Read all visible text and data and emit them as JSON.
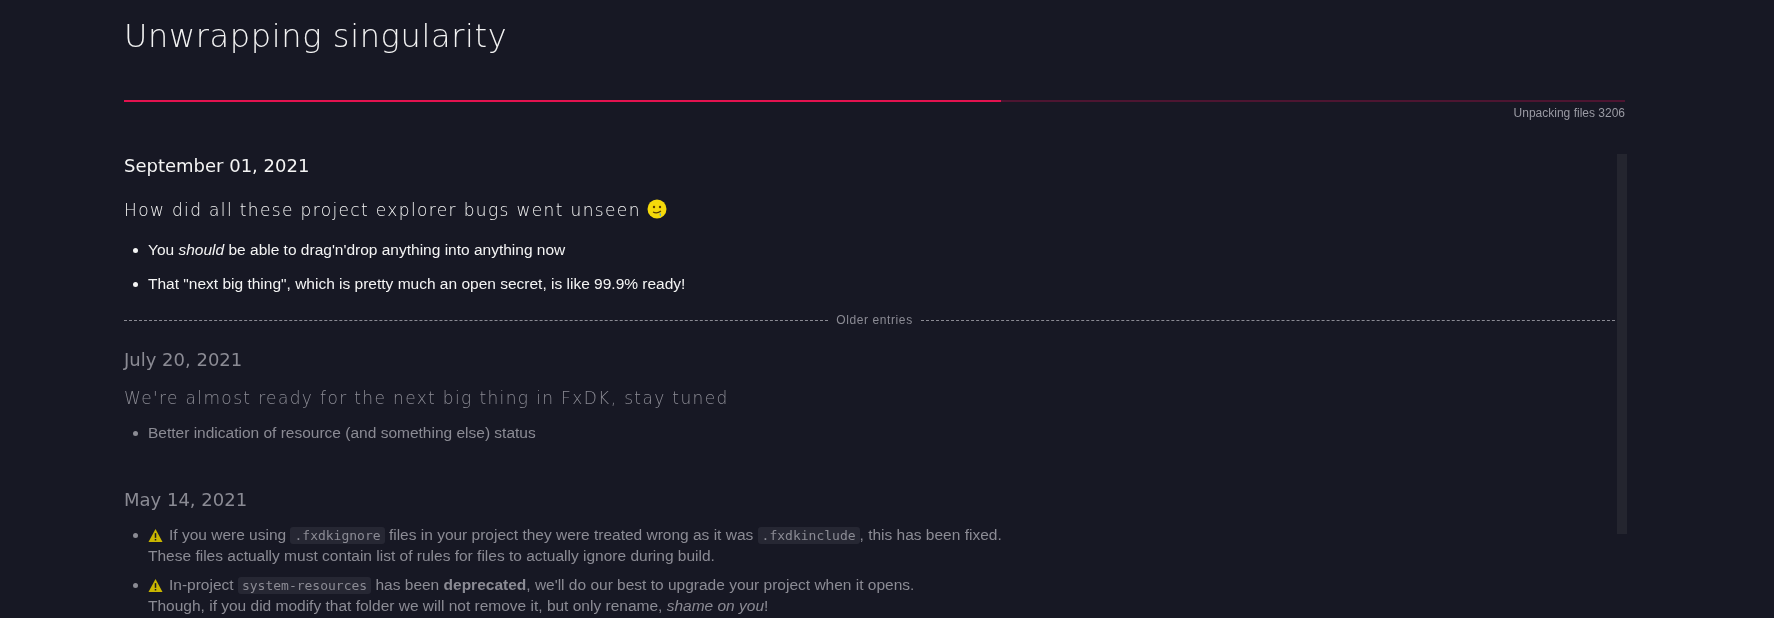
{
  "title": "Unwrapping singularity",
  "progress": {
    "level": 0.584,
    "status": "Unpacking files 3206"
  },
  "latest": {
    "date": "September 01, 2021",
    "heading": "How did all these project explorer bugs went unseen",
    "heading_emoji": true,
    "items": [
      {
        "warning": false,
        "lines": [
          [
            {
              "kind": "text",
              "text": "You *should* be able to drag'n'drop anything into anything now"
            }
          ]
        ]
      },
      {
        "warning": false,
        "lines": [
          [
            {
              "kind": "text",
              "text": "That \"next big thing\", which is pretty much an open secret, is like 99.9% ready!"
            }
          ]
        ]
      }
    ]
  },
  "older_label": "Older entries",
  "older": [
    {
      "date": "July 20, 2021",
      "heading": "We're almost ready for the next big thing in FxDK, stay tuned",
      "heading_emoji": false,
      "items": [
        {
          "warning": false,
          "lines": [
            [
              {
                "kind": "text",
                "text": "Better indication of resource (and something else) status"
              }
            ]
          ]
        }
      ]
    },
    {
      "date": "May 14, 2021",
      "items": [
        {
          "warning": true,
          "lines": [
            [
              {
                "kind": "text",
                "text": "If you were using "
              },
              {
                "kind": "code",
                "text": ".fxdkignore"
              },
              {
                "kind": "text",
                "text": " files in your project they were treated wrong as it was "
              },
              {
                "kind": "code",
                "text": ".fxdkinclude"
              },
              {
                "kind": "text",
                "text": ", this has been fixed."
              }
            ],
            [
              {
                "kind": "text",
                "text": "These files actually must contain list of rules for files to actually ignore during build."
              }
            ]
          ]
        },
        {
          "warning": true,
          "lines": [
            [
              {
                "kind": "text",
                "text": "In-project "
              },
              {
                "kind": "code",
                "text": "system-resources"
              },
              {
                "kind": "text",
                "text": " has been **deprecated**, we'll do our best to upgrade your project when it opens."
              }
            ],
            [
              {
                "kind": "text",
                "text": "Though, if you did modify that folder we will not remove it, but only rename, *shame on you*!"
              }
            ]
          ]
        }
      ]
    }
  ]
}
